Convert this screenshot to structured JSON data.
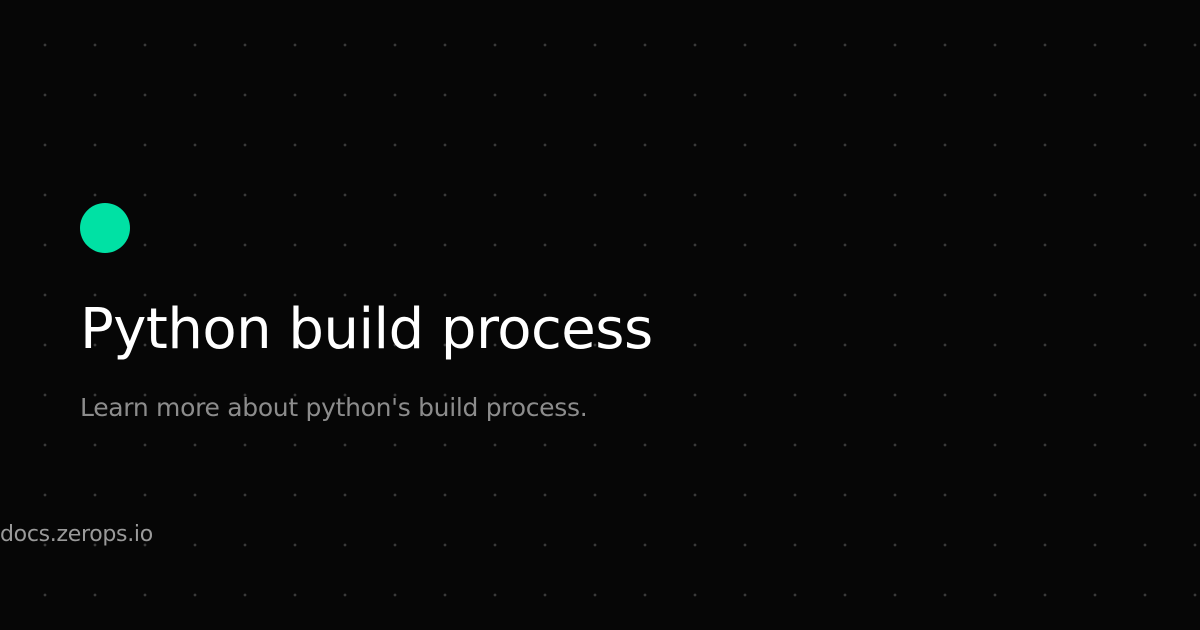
{
  "card": {
    "title": "Python build process",
    "subtitle": "Learn more about python's build process.",
    "site": "docs.zerops.io",
    "accent_icon": "green-circle-icon",
    "colors": {
      "background": "#060606",
      "accent": "#00e1a4",
      "title": "#ffffff",
      "subtitle": "#8c8c8c",
      "site": "#9a9a9a"
    }
  }
}
